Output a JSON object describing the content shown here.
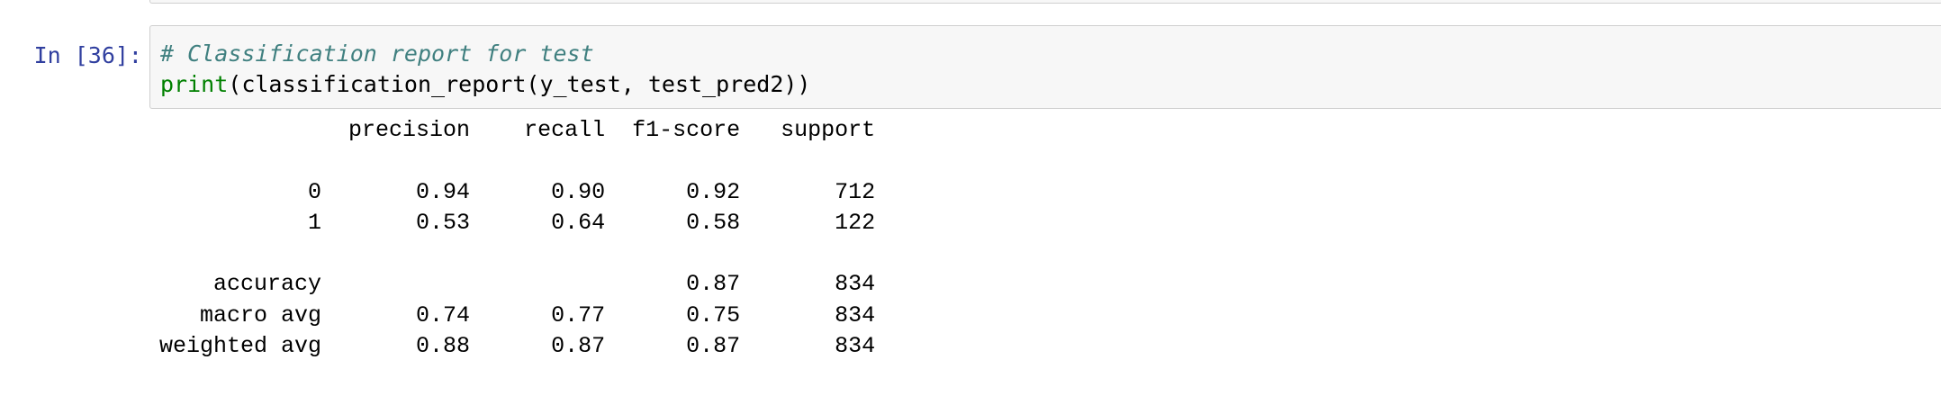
{
  "cell": {
    "prompt": "In [36]:",
    "code_comment": "# Classification report for test",
    "code_builtin": "print",
    "code_rest": "(classification_report(y_test, test_pred2))"
  },
  "output": {
    "lines": [
      "              precision    recall  f1-score   support",
      "",
      "           0       0.94      0.90      0.92       712",
      "           1       0.53      0.64      0.58       122",
      "",
      "    accuracy                           0.87       834",
      "   macro avg       0.74      0.77      0.75       834",
      "weighted avg       0.88      0.87      0.87       834"
    ],
    "report": {
      "columns": [
        "precision",
        "recall",
        "f1-score",
        "support"
      ],
      "rows": [
        {
          "label": "0",
          "precision": "0.94",
          "recall": "0.90",
          "f1-score": "0.92",
          "support": "712"
        },
        {
          "label": "1",
          "precision": "0.53",
          "recall": "0.64",
          "f1-score": "0.58",
          "support": "122"
        },
        {
          "label": "accuracy",
          "precision": "",
          "recall": "",
          "f1-score": "0.87",
          "support": "834"
        },
        {
          "label": "macro avg",
          "precision": "0.74",
          "recall": "0.77",
          "f1-score": "0.75",
          "support": "834"
        },
        {
          "label": "weighted avg",
          "precision": "0.88",
          "recall": "0.87",
          "f1-score": "0.87",
          "support": "834"
        }
      ]
    }
  },
  "colors": {
    "prompt": "#303f9f",
    "comment": "#408080",
    "builtin": "#008000",
    "cell_background": "#f7f7f7",
    "cell_border": "#cfcfcf"
  }
}
